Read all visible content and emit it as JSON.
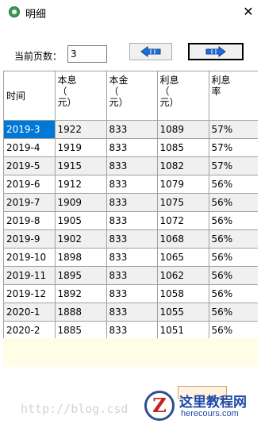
{
  "window": {
    "title": "明细",
    "close_symbol": "✕"
  },
  "pager": {
    "label": "当前页数：",
    "current_page": "3"
  },
  "table": {
    "headers": [
      {
        "lines": [
          "时间"
        ]
      },
      {
        "lines": [
          "本息",
          "（",
          "元）"
        ]
      },
      {
        "lines": [
          "本金",
          "（",
          "元）"
        ]
      },
      {
        "lines": [
          "利息",
          "（",
          "元）"
        ]
      },
      {
        "lines": [
          "利息",
          "率"
        ]
      }
    ],
    "rows": [
      [
        "2019-3",
        "1922",
        "833",
        "1089",
        "57%"
      ],
      [
        "2019-4",
        "1919",
        "833",
        "1085",
        "57%"
      ],
      [
        "2019-5",
        "1915",
        "833",
        "1082",
        "57%"
      ],
      [
        "2019-6",
        "1912",
        "833",
        "1079",
        "56%"
      ],
      [
        "2019-7",
        "1909",
        "833",
        "1075",
        "56%"
      ],
      [
        "2019-8",
        "1905",
        "833",
        "1072",
        "56%"
      ],
      [
        "2019-9",
        "1902",
        "833",
        "1068",
        "56%"
      ],
      [
        "2019-10",
        "1898",
        "833",
        "1065",
        "56%"
      ],
      [
        "2019-11",
        "1895",
        "833",
        "1062",
        "56%"
      ],
      [
        "2019-12",
        "1892",
        "833",
        "1058",
        "56%"
      ],
      [
        "2020-1",
        "1888",
        "833",
        "1055",
        "56%"
      ],
      [
        "2020-2",
        "1885",
        "833",
        "1051",
        "56%"
      ]
    ]
  },
  "watermark": "http://blog.csd",
  "logo": {
    "name": "这里教程网",
    "url": "herecours.com"
  },
  "colors": {
    "selection": "#0078d7",
    "arrow": "#1e6fd9",
    "alt_row": "#f0f0f0",
    "empty_area": "#fffde6"
  },
  "icons": {
    "prev": "arrow-left-icon",
    "next": "arrow-right-icon",
    "app": "app-icon"
  }
}
